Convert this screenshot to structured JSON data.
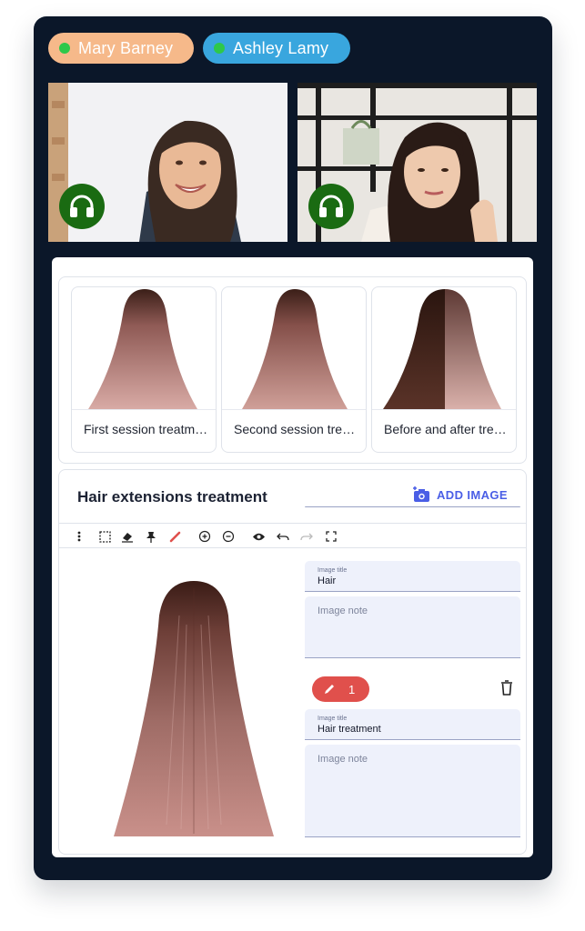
{
  "participants": [
    {
      "name": "Mary Barney",
      "color": "#f6b98a",
      "status_color": "#2ec84a"
    },
    {
      "name": "Ashley Lamy",
      "color": "#39a6de",
      "status_color": "#2ec84a"
    }
  ],
  "video_icons": [
    "headset-icon",
    "headset-icon"
  ],
  "gallery": {
    "items": [
      {
        "title": "First session treatment"
      },
      {
        "title": "Second session treatment"
      },
      {
        "title": "Before and after treatment"
      }
    ]
  },
  "editor": {
    "title": "Hair extensions treatment",
    "add_image_label": "ADD IMAGE",
    "toolbar_icons": [
      "more-vert-icon",
      "select-area-icon",
      "eraser-icon",
      "pin-icon",
      "pen-icon",
      "zoom-in-icon",
      "zoom-out-icon",
      "eye-icon",
      "undo-icon",
      "redo-icon",
      "fullscreen-icon"
    ],
    "image_title_field": {
      "label": "Image title",
      "value": "Hair"
    },
    "image_note_field": {
      "placeholder": "Image note"
    },
    "annotation": {
      "count": "1",
      "icon": "pen-icon"
    },
    "annotation_title_field": {
      "label": "Image title",
      "value": "Hair treatment"
    },
    "annotation_note_field": {
      "placeholder": "Image note"
    }
  },
  "colors": {
    "frame": "#0b1729",
    "accent": "#4a5ee6",
    "badge": "#e0504c",
    "headset_bg": "#1a6b12"
  }
}
